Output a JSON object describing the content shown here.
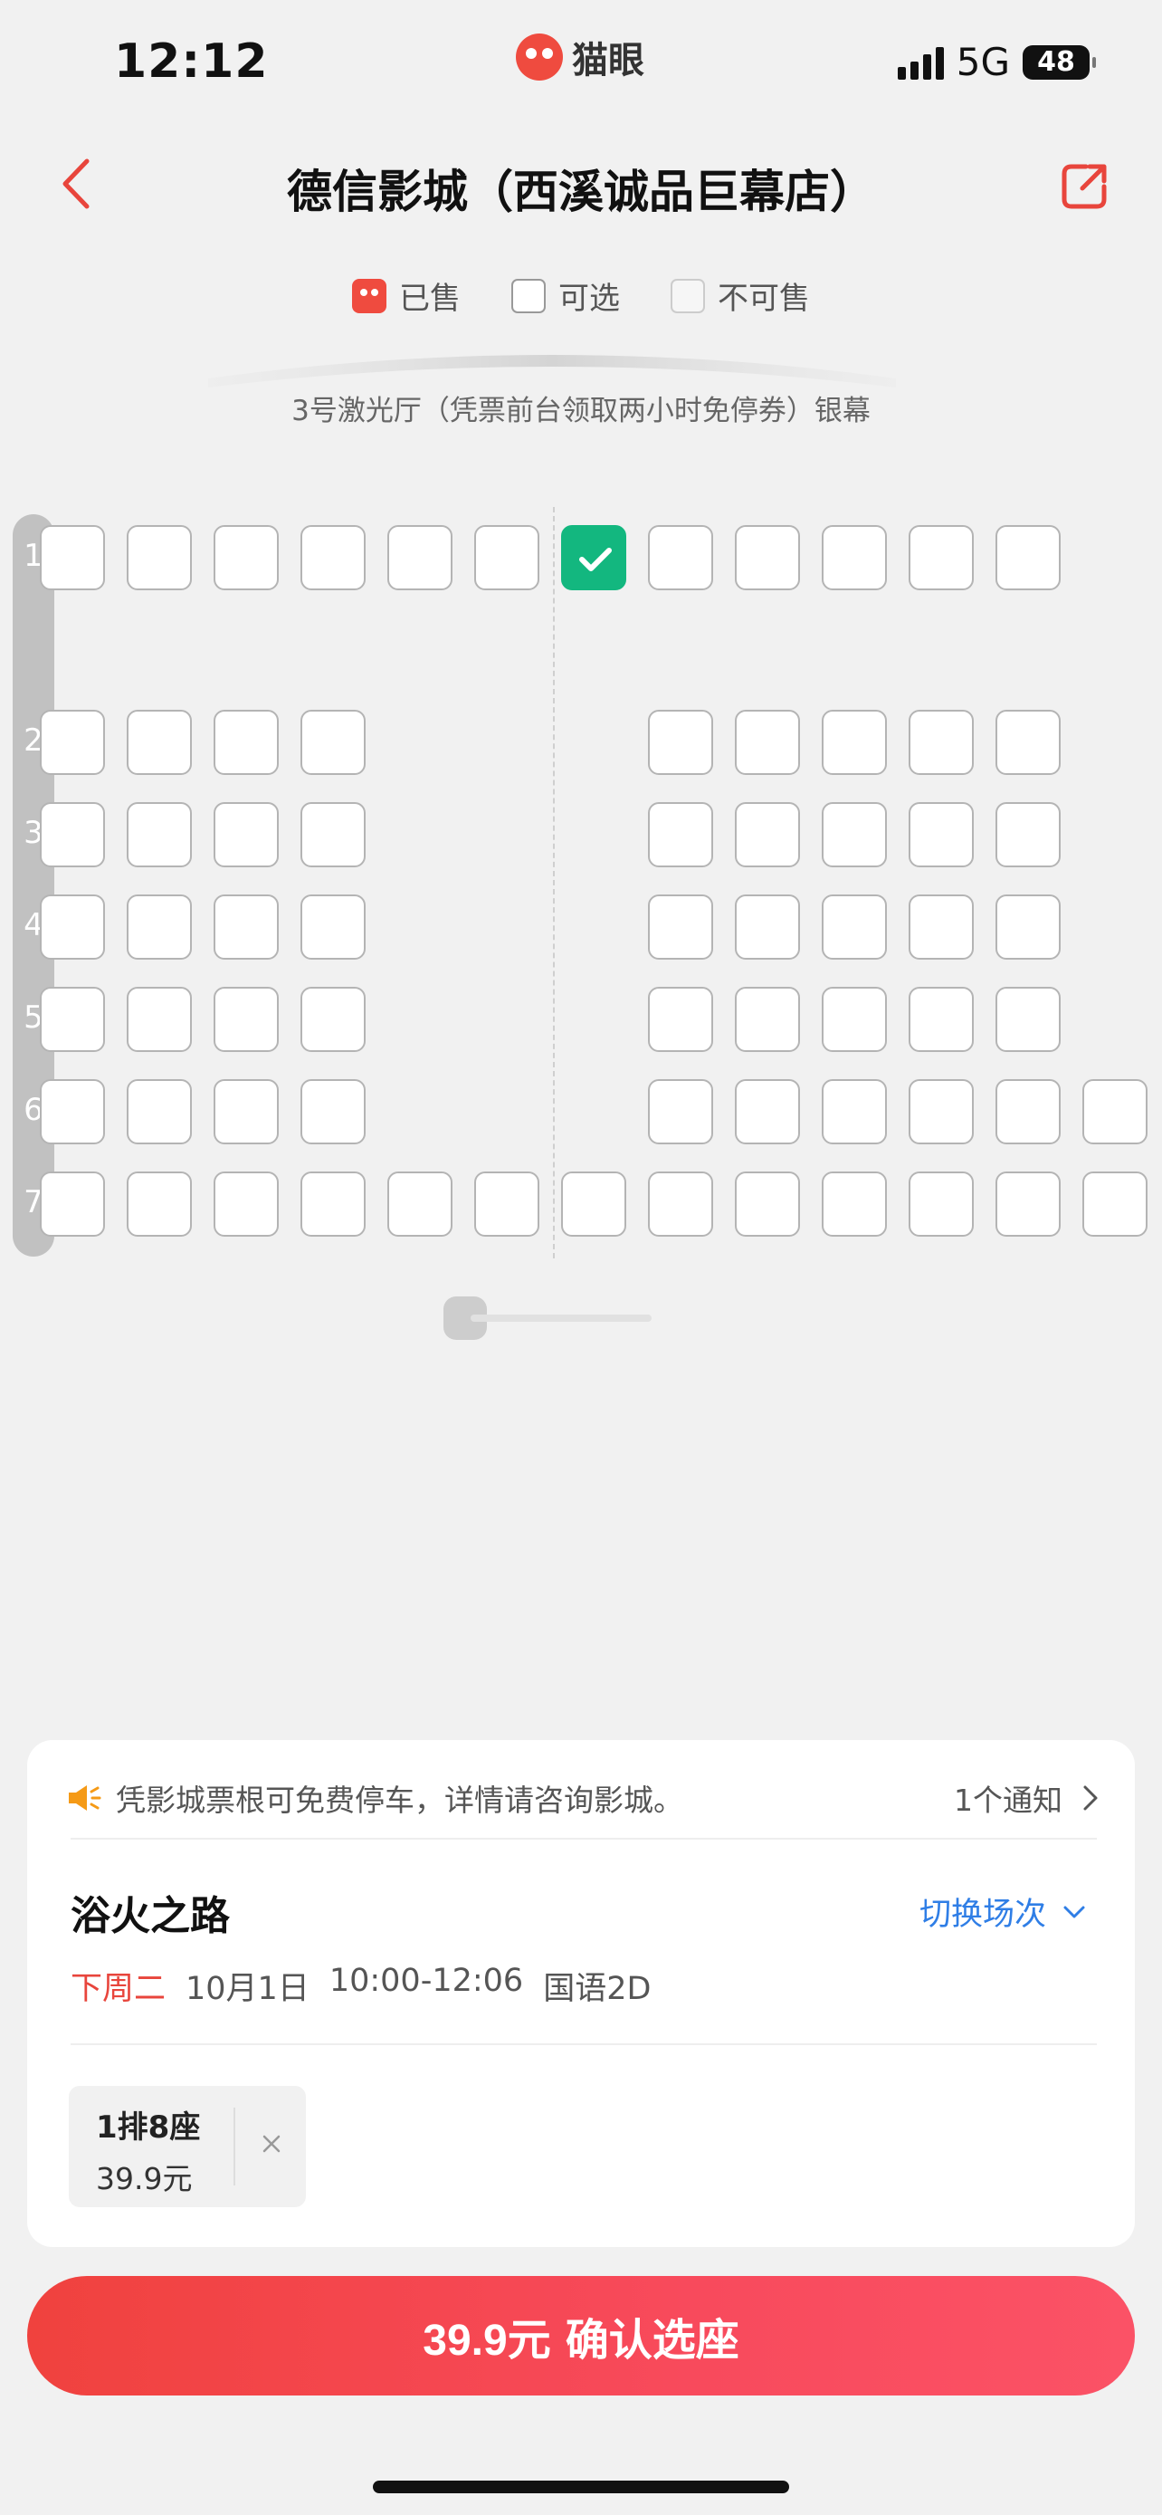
{
  "status": {
    "time": "12:12",
    "network": "5G",
    "battery": "48",
    "app_brand": "猫眼"
  },
  "nav": {
    "title": "德信影城（西溪诚品巨幕店）"
  },
  "legend": {
    "sold": "已售",
    "available": "可选",
    "unavailable": "不可售"
  },
  "hall": {
    "label": "3号激光厅（凭票前台领取两小时免停券）银幕"
  },
  "seat_map": {
    "rows": [
      "1",
      "2",
      "3",
      "4",
      "5",
      "6",
      "7"
    ],
    "selected_seat": "1排8座",
    "colors": {
      "selected": "#13b77f",
      "available_border": "#b4b4b4"
    }
  },
  "notice": {
    "text": "凭影城票根可免费停车，详情请咨询影城。",
    "count": "1个通知"
  },
  "movie": {
    "title": "浴火之路",
    "switch_label": "切换场次",
    "day": "下周二",
    "date": "10月1日",
    "time": "10:00-12:06",
    "format": "国语2D"
  },
  "selection": {
    "seat": "1排8座",
    "price": "39.9元"
  },
  "confirm": {
    "price": "39.9元",
    "label": "确认选座"
  },
  "colors": {
    "accent": "#f0423e",
    "link": "#2f7ee6",
    "background": "#f1f1f1"
  }
}
